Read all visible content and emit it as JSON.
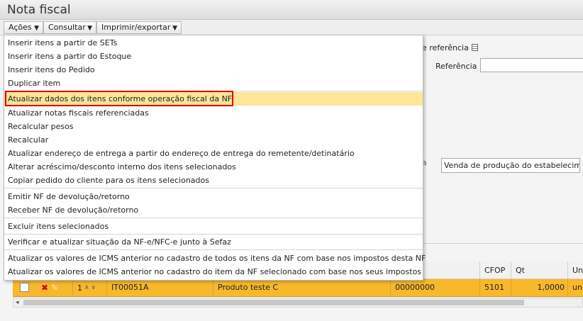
{
  "window": {
    "title": "Nota fiscal"
  },
  "toolbar": {
    "menus": [
      {
        "label": "Ações"
      },
      {
        "label": "Consultar"
      },
      {
        "label": "Imprimir/exportar"
      }
    ]
  },
  "actions_menu": {
    "items": [
      "Inserir itens a partir de SETs",
      "Inserir itens a partir do Estoque",
      "Inserir itens do Pedido",
      "Duplicar item",
      "Atualizar dados dos itens conforme operação fiscal da NF",
      "Atualizar notas fiscais referenciadas",
      "Recalcular pesos",
      "Recalcular",
      "Atualizar endereço de entrega a partir do endereço de entrega do remetente/detinatário",
      "Alterar acréscimo/desconto interno dos itens selecionados",
      "Copiar pedido do cliente para os itens selecionados",
      "Emitir NF de devolução/retorno",
      "Receber NF de devolução/retorno",
      "Excluir itens selecionados",
      "Verificar e atualizar situação da NF-e/NFC-e junto à Sefaz",
      "Atualizar os valores de ICMS anterior no cadastro de todos os itens da NF com base nos impostos desta NF",
      "Atualizar os valores de ICMS anterior no cadastro do item da NF selecionado com base nos seus impostos"
    ],
    "highlighted_index": 4
  },
  "form": {
    "ref_checkbox_label": "e referência",
    "ref_label": "Referência",
    "ref_value": "",
    "nature_label_fragment": "a",
    "nature_value": "Venda de produção do estabelecime"
  },
  "grid": {
    "columns": [
      "CFOP",
      "Qt",
      "Un"
    ],
    "row": {
      "seq": "1",
      "code": "IT00051A",
      "description": "Produto teste C",
      "ncm": "00000000",
      "cfop": "5101",
      "qty": "1,0000",
      "unit": "un"
    }
  },
  "colors": {
    "highlight_row": "#f7b82c",
    "menu_hover": "#fde59a",
    "callout_border": "#e00000"
  }
}
